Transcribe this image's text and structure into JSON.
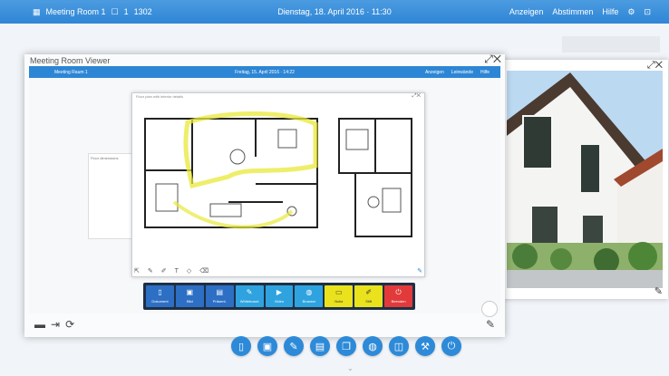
{
  "topbar": {
    "room_label": "Meeting Room 1",
    "users": "1",
    "extra": "1302",
    "datetime": "Dienstag, 18. April 2016 · 11:30",
    "actions": [
      "Anzeigen",
      "Abstimmen",
      "Hilfe"
    ],
    "icons": [
      "gear-icon",
      "close-icon"
    ]
  },
  "main_window": {
    "title": "Meeting Room Viewer",
    "inner_bar": {
      "room": "Meeting Raum 1",
      "datetime": "Freitag, 15. April 2016 · 14:22",
      "actions": [
        "Anzeigen",
        "Leinwände",
        "Hilfe"
      ]
    },
    "floorplan_title": "Floor plan with interior details",
    "side_panel_title": "Floor dimensions",
    "toolbar_buttons": [
      {
        "label": "Dokument",
        "icon": "document-icon",
        "color": "#2d6fc4"
      },
      {
        "label": "Bild",
        "icon": "image-icon",
        "color": "#2d6fc4"
      },
      {
        "label": "Präsent.",
        "icon": "presentation-icon",
        "color": "#2d6fc4"
      },
      {
        "label": "Whiteboard",
        "icon": "whiteboard-icon",
        "color": "#2fa3e0"
      },
      {
        "label": "Video",
        "icon": "video-icon",
        "color": "#2fa3e0"
      },
      {
        "label": "Browser",
        "icon": "globe-icon",
        "color": "#2fa3e0"
      },
      {
        "label": "Notiz",
        "icon": "note-icon",
        "color": "#e9e21c"
      },
      {
        "label": "Stift",
        "icon": "pen-icon",
        "color": "#e9e21c"
      },
      {
        "label": "Beenden",
        "icon": "power-icon",
        "color": "#e23a3a"
      }
    ]
  },
  "dock": [
    {
      "name": "document-icon",
      "glyph": "▯"
    },
    {
      "name": "image-icon",
      "glyph": "▣"
    },
    {
      "name": "pen-icon",
      "glyph": "✎"
    },
    {
      "name": "presentation-icon",
      "glyph": "▤"
    },
    {
      "name": "copy-icon",
      "glyph": "❐"
    },
    {
      "name": "globe-icon",
      "glyph": "◍"
    },
    {
      "name": "camera-icon",
      "glyph": "◫"
    },
    {
      "name": "wrench-icon",
      "glyph": "⚒"
    },
    {
      "name": "power-icon",
      "glyph": "⏻"
    }
  ],
  "colors": {
    "accent": "#2d86d5",
    "toolbar_bg": "#1e2f45"
  }
}
